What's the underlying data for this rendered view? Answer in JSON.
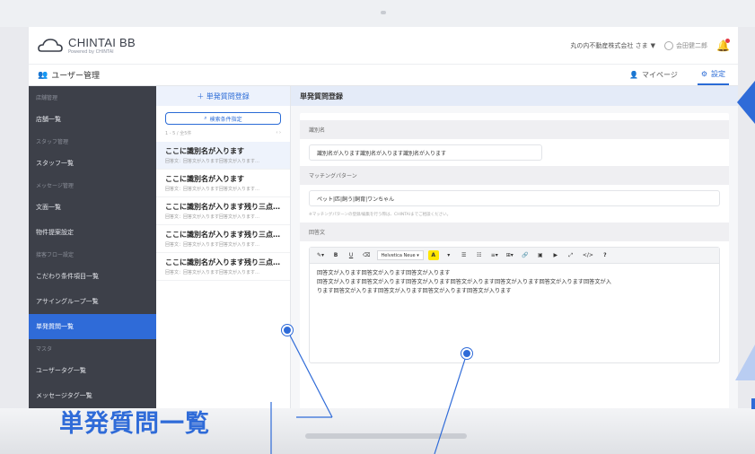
{
  "header": {
    "logo_main": "CHINTAI BB",
    "logo_sub": "Powered by CHINTAI",
    "company": "丸の内不動産株式会社 さま",
    "user": "会田健二郎"
  },
  "subheader": {
    "title": "ユーザー管理",
    "mypage": "マイページ",
    "settings": "設定"
  },
  "sidebar": {
    "groups": [
      {
        "label": "店舗管理",
        "items": [
          "店舗一覧"
        ]
      },
      {
        "label": "スタッフ管理",
        "items": [
          "スタッフ一覧"
        ]
      },
      {
        "label": "メッセージ管理",
        "items": [
          "文面一覧",
          "物件提案設定"
        ]
      },
      {
        "label": "接客フロー設定",
        "items": [
          "こだわり条件項目一覧",
          "アサイングループ一覧",
          "単発質問一覧"
        ]
      },
      {
        "label": "マスタ",
        "items": [
          "ユーザータグ一覧",
          "メッセージタグ一覧"
        ]
      }
    ],
    "active": "単発質問一覧"
  },
  "list": {
    "add_label": "＋ 単発質問登録",
    "search_label": "検索条件指定",
    "count": "1 - 5 / 全5件",
    "items": [
      {
        "title": "ここに識別名が入ります",
        "sub": "回答文：回答文が入ります回答文が入ります…"
      },
      {
        "title": "ここに識別名が入ります",
        "sub": "回答文：回答文が入ります回答文が入ります…"
      },
      {
        "title": "ここに識別名が入ります残り三点…",
        "sub": "回答文：回答文が入ります回答文が入ります…"
      },
      {
        "title": "ここに識別名が入ります残り三点…",
        "sub": "回答文：回答文が入ります回答文が入ります…"
      },
      {
        "title": "ここに識別名が入ります残り三点…",
        "sub": "回答文：回答文が入ります回答文が入ります…"
      }
    ]
  },
  "form": {
    "title": "単発質問登録",
    "name_label": "識別名",
    "name_value": "識別名が入ります識別名が入ります識別名が入ります",
    "pattern_label": "マッチングパターン",
    "pattern_value": "ペット|匹|飼う|飼育|ワンちゃん",
    "pattern_note": "※マッチングパターンの登録/編集を行う際は、CHINTAIまでご相談ください。",
    "answer_label": "回答文",
    "font_name": "Helvetica Neue",
    "answer_lines": [
      "回答文が入ります回答文が入ります回答文が入ります",
      "回答文が入ります回答文が入ります回答文が入ります回答文が入ります回答文が入ります回答文が入ります回答文が入",
      "ります回答文が入ります回答文が入ります回答文が入ります回答文が入ります"
    ]
  },
  "callout": {
    "label": "単発質問一覧"
  },
  "colors": {
    "accent": "#2f6bd8",
    "sidebar_bg": "#3d4049"
  }
}
